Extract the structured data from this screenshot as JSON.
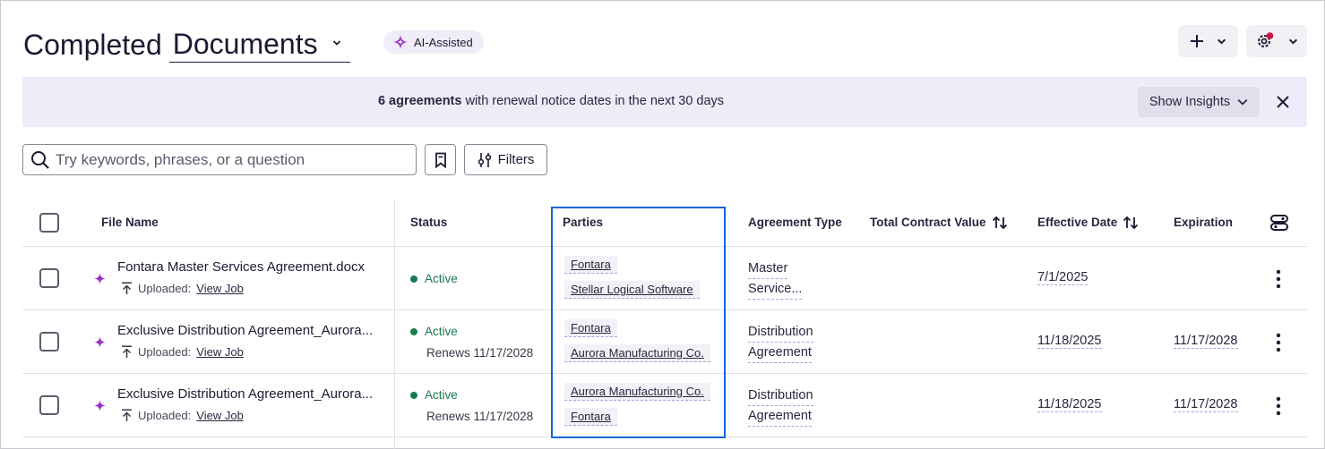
{
  "header": {
    "title_prefix": "Completed",
    "title_view": "Documents",
    "ai_badge": "AI-Assisted"
  },
  "banner": {
    "count_text": "6 agreements",
    "message": " with renewal notice dates in the next 30 days",
    "insights_label": "Show Insights"
  },
  "search": {
    "placeholder": "Try keywords, phrases, or a question",
    "filters_label": "Filters"
  },
  "table": {
    "columns": {
      "file_name": "File Name",
      "status": "Status",
      "parties": "Parties",
      "agreement_type": "Agreement Type",
      "total_value": "Total Contract Value",
      "effective_date": "Effective Date",
      "expiration": "Expiration"
    },
    "rows": [
      {
        "file_name": "Fontara Master Services Agreement.docx",
        "upload_label": "Uploaded:",
        "upload_link": "View Job",
        "status": "Active",
        "renews": "",
        "parties": [
          "Fontara",
          "Stellar Logical Software"
        ],
        "type_line1": "Master",
        "type_line2": "Service...",
        "effective": "7/1/2025",
        "expiration": ""
      },
      {
        "file_name": "Exclusive Distribution Agreement_Aurora...",
        "upload_label": "Uploaded:",
        "upload_link": "View Job",
        "status": "Active",
        "renews": "Renews 11/17/2028",
        "parties": [
          "Fontara",
          "Aurora Manufacturing Co."
        ],
        "type_line1": "Distribution",
        "type_line2": "Agreement",
        "effective": "11/18/2025",
        "expiration": "11/17/2028"
      },
      {
        "file_name": "Exclusive Distribution Agreement_Aurora...",
        "upload_label": "Uploaded:",
        "upload_link": "View Job",
        "status": "Active",
        "renews": "Renews 11/17/2028",
        "parties": [
          "Aurora Manufacturing Co.",
          "Fontara"
        ],
        "type_line1": "Distribution",
        "type_line2": "Agreement",
        "effective": "11/18/2025",
        "expiration": "11/17/2028"
      }
    ]
  },
  "colors": {
    "accent_purple": "#9b2fc9",
    "status_green": "#1a7a4f",
    "highlight_blue": "#1565d8",
    "banner_bg": "#efebf9"
  }
}
